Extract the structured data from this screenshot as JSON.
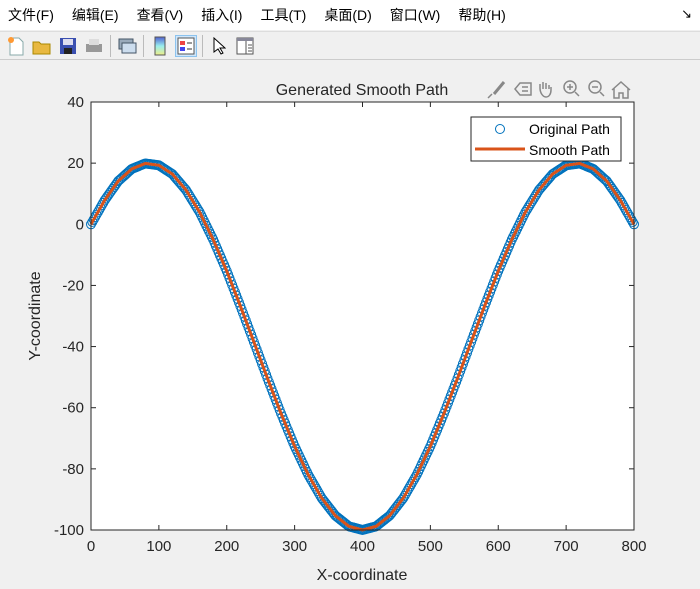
{
  "menu": [
    "文件(F)",
    "编辑(E)",
    "查看(V)",
    "插入(I)",
    "工具(T)",
    "桌面(D)",
    "窗口(W)",
    "帮助(H)"
  ],
  "toolbar": [
    "new-file-icon",
    "open-folder-icon",
    "save-icon",
    "print-icon",
    "link-plot-icon",
    "colorbar-icon",
    "legend-icon",
    "pointer-icon",
    "property-editor-icon"
  ],
  "axes_toolbar": [
    "brush-icon",
    "data-tip-icon",
    "pan-icon",
    "zoom-in-icon",
    "zoom-out-icon",
    "home-icon"
  ],
  "colors": {
    "original": "#0072BD",
    "smooth": "#D95319"
  },
  "chart_data": {
    "type": "line",
    "title": "Generated Smooth Path",
    "xlabel": "X-coordinate",
    "ylabel": "Y-coordinate",
    "xlim": [
      0,
      800
    ],
    "ylim": [
      -100,
      40
    ],
    "xticks": [
      "0",
      "100",
      "200",
      "300",
      "400",
      "500",
      "600",
      "700",
      "800"
    ],
    "yticks": [
      "40",
      "20",
      "0",
      "-20",
      "-40",
      "-60",
      "-80",
      "-100"
    ],
    "legend": {
      "placement": "top-right",
      "entries": [
        "Original Path",
        "Smooth Path"
      ]
    },
    "x": [
      0,
      20,
      40,
      60,
      80,
      100,
      120,
      140,
      160,
      180,
      200,
      220,
      240,
      260,
      280,
      300,
      320,
      340,
      360,
      380,
      400,
      420,
      440,
      460,
      480,
      500,
      520,
      540,
      560,
      580,
      600,
      620,
      640,
      660,
      680,
      700,
      720,
      740,
      760,
      780,
      800
    ],
    "series": [
      {
        "name": "Original Path",
        "marker": "circle",
        "y": [
          0,
          7.8,
          14.1,
          18.1,
          19.9,
          19.3,
          16.4,
          11.2,
          4.0,
          -5.0,
          -15.3,
          -26.7,
          -38.5,
          -50.4,
          -61.9,
          -72.6,
          -81.9,
          -89.6,
          -95.3,
          -98.8,
          -100,
          -98.8,
          -95.3,
          -89.6,
          -81.9,
          -72.6,
          -61.9,
          -50.4,
          -38.5,
          -26.7,
          -15.3,
          -5.0,
          4.0,
          11.2,
          16.4,
          19.3,
          19.9,
          18.1,
          14.1,
          7.8,
          0
        ]
      },
      {
        "name": "Smooth Path",
        "marker": "line",
        "y": [
          0,
          7.8,
          14.1,
          18.1,
          19.9,
          19.3,
          16.4,
          11.2,
          4.0,
          -5.0,
          -15.3,
          -26.7,
          -38.5,
          -50.4,
          -61.9,
          -72.6,
          -81.9,
          -89.6,
          -95.3,
          -98.8,
          -100,
          -98.8,
          -95.3,
          -89.6,
          -81.9,
          -72.6,
          -61.9,
          -50.4,
          -38.5,
          -26.7,
          -15.3,
          -5.0,
          4.0,
          11.2,
          16.4,
          19.3,
          19.9,
          18.1,
          14.1,
          7.8,
          0
        ]
      }
    ]
  }
}
